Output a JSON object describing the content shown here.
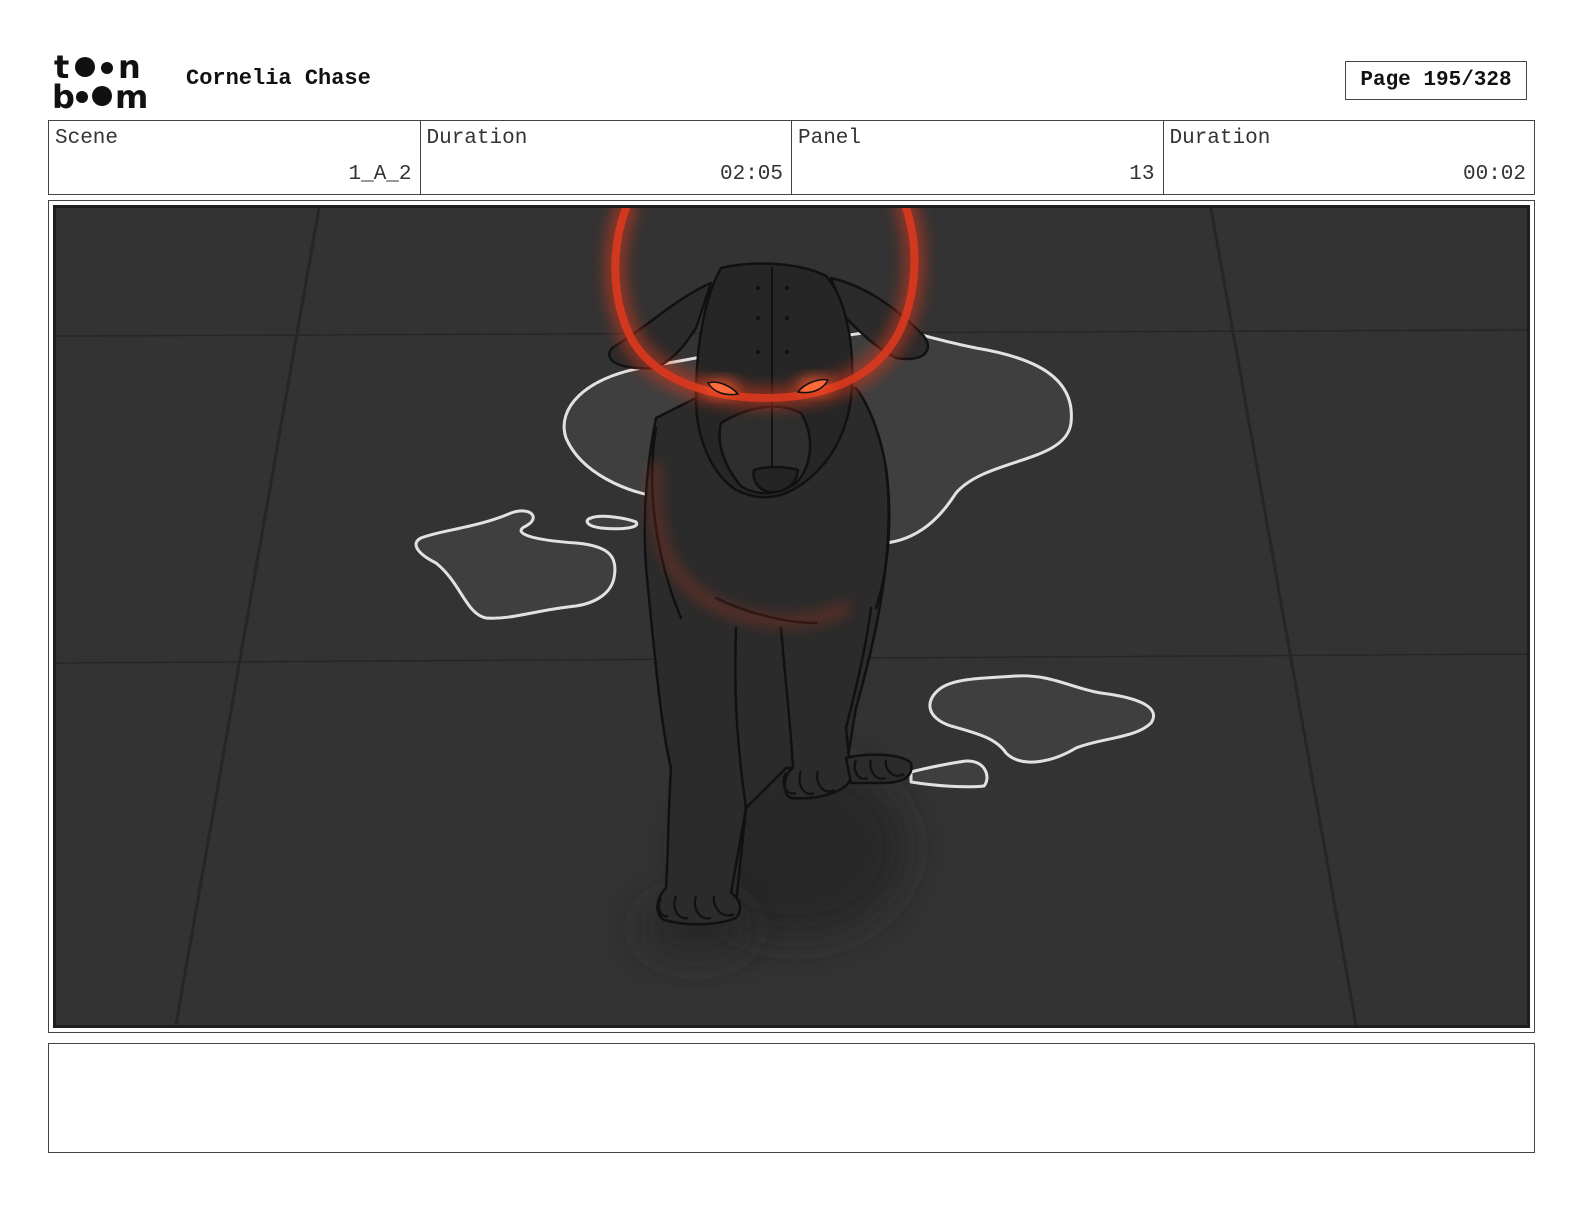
{
  "header": {
    "logo_text": "toon boom",
    "project_title": "Cornelia Chase",
    "page_label": "Page 195/328"
  },
  "info": {
    "scene_label": "Scene",
    "scene_value": "1_A_2",
    "scene_duration_label": "Duration",
    "scene_duration_value": "02:05",
    "panel_label": "Panel",
    "panel_value": "13",
    "panel_duration_label": "Duration",
    "panel_duration_value": "00:02"
  },
  "panel_image": {
    "icon": "storyboard-sketch",
    "colors": {
      "floor": "#333333",
      "puddle": "#3f3f3f",
      "puddle_outline": "#e2e2e2",
      "creature": "#2b2b2b",
      "glow": "#d9381e",
      "eyes": "#ff5a2a"
    }
  },
  "notes": {
    "text": ""
  }
}
